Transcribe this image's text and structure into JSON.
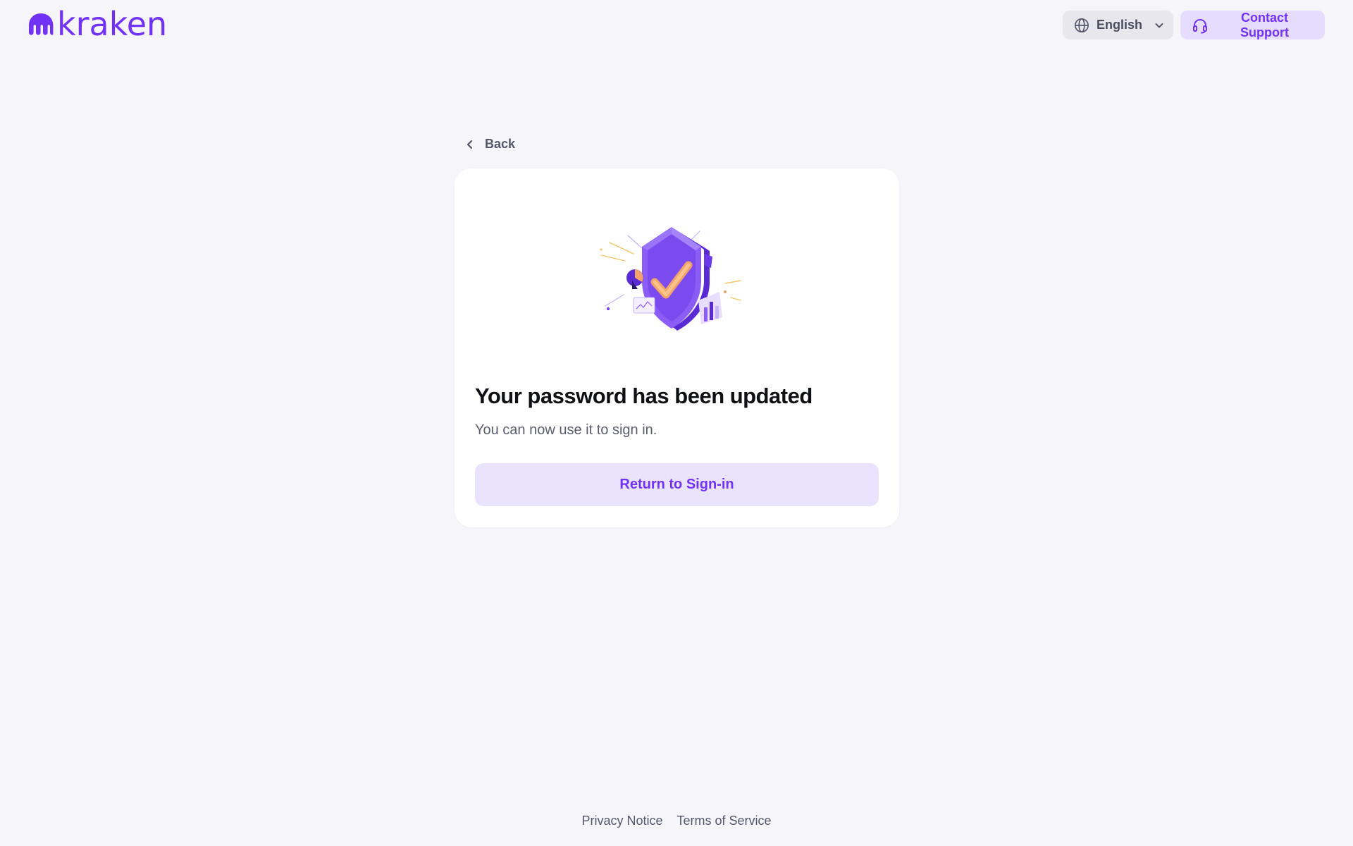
{
  "header": {
    "logo_text": "kraken",
    "language_label": "English",
    "support_label": "Contact Support"
  },
  "nav": {
    "back_label": "Back"
  },
  "card": {
    "title": "Your password has been updated",
    "subtitle": "You can now use it to sign in.",
    "button_label": "Return to Sign-in"
  },
  "footer": {
    "privacy_label": "Privacy Notice",
    "terms_label": "Terms of Service"
  },
  "colors": {
    "brand": "#7132f5",
    "background": "#f5f5fa",
    "card": "#ffffff",
    "button_bg": "#e9e3fd"
  },
  "icons": [
    "kraken-logo-icon",
    "globe-icon",
    "chevron-down-icon",
    "headset-icon",
    "chevron-left-icon",
    "shield-check-illustration"
  ]
}
